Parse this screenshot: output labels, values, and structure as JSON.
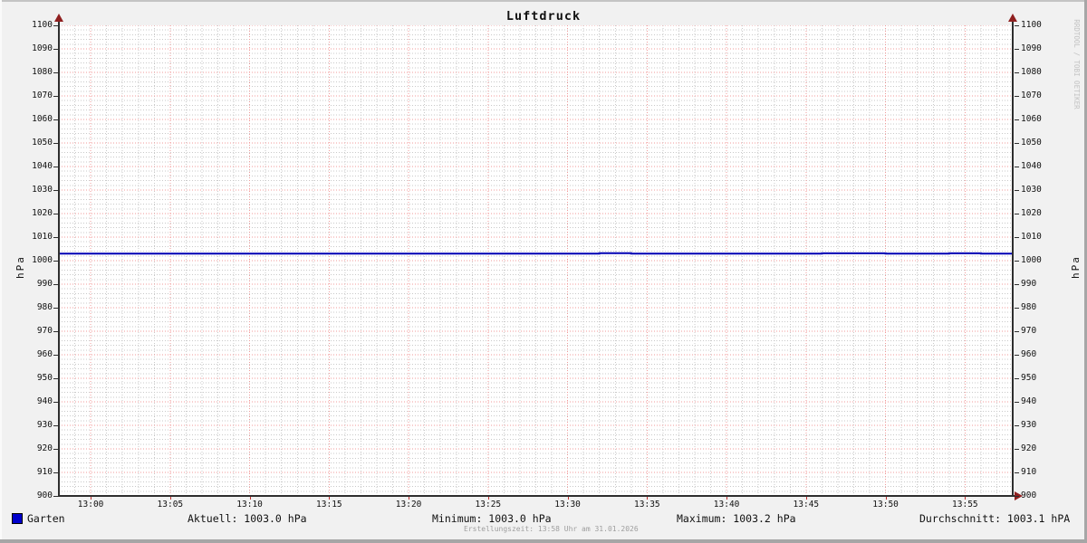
{
  "title": "Luftdruck",
  "axis_units": {
    "left": "hPa",
    "right": "hPa"
  },
  "watermark": "RRDTOOL / TOBI OETIKER",
  "footer": "Erstellungszeit: 13:58 Uhr am 31.01.2026",
  "legend": {
    "series_label": "Garten",
    "series_color": "#0000cc",
    "stats": [
      {
        "label": "Aktuell: 1003.0 hPa"
      },
      {
        "label": "Minimum: 1003.0 hPa"
      },
      {
        "label": "Maximum: 1003.2 hPa"
      },
      {
        "label": "Durchschnitt: 1003.1 hPA"
      }
    ]
  },
  "chart_data": {
    "type": "line",
    "title": "Luftdruck",
    "xlabel": "",
    "ylabel": "hPa",
    "ylim": [
      900,
      1100
    ],
    "y_tick_step": 10,
    "y_minor_step": 2,
    "y_tick_labels": [
      "900",
      "910",
      "920",
      "930",
      "940",
      "950",
      "960",
      "970",
      "980",
      "990",
      "1000",
      "1010",
      "1020",
      "1030",
      "1040",
      "1050",
      "1060",
      "1070",
      "1080",
      "1090",
      "1100"
    ],
    "x_range": [
      "12:58",
      "13:58"
    ],
    "x_tick_labels": [
      "13:00",
      "13:05",
      "13:10",
      "13:15",
      "13:20",
      "13:25",
      "13:30",
      "13:35",
      "13:40",
      "13:45",
      "13:50",
      "13:55"
    ],
    "x_minor_step_minutes": 1,
    "grid": true,
    "legend_position": "bottom",
    "colors": {
      "line": "#0000b4",
      "grid_major": "#f09a9a",
      "grid_minor": "#c9c9c9",
      "axis": "#2e2e2e",
      "arrow": "#8f1f1f",
      "background": "#f1f1f1",
      "plot_background": "#ffffff"
    },
    "series": [
      {
        "name": "Garten",
        "color": "#0000b4",
        "points": [
          [
            "12:58",
            1003.0
          ],
          [
            "13:32",
            1003.0
          ],
          [
            "13:32",
            1003.2
          ],
          [
            "13:34",
            1003.2
          ],
          [
            "13:34",
            1003.0
          ],
          [
            "13:46",
            1003.0
          ],
          [
            "13:46",
            1003.1
          ],
          [
            "13:50",
            1003.1
          ],
          [
            "13:50",
            1003.0
          ],
          [
            "13:54",
            1003.0
          ],
          [
            "13:54",
            1003.1
          ],
          [
            "13:56",
            1003.1
          ],
          [
            "13:56",
            1003.0
          ],
          [
            "13:58",
            1003.0
          ]
        ]
      }
    ],
    "stats": {
      "current": 1003.0,
      "min": 1003.0,
      "max": 1003.2,
      "avg": 1003.1,
      "unit": "hPa"
    }
  }
}
